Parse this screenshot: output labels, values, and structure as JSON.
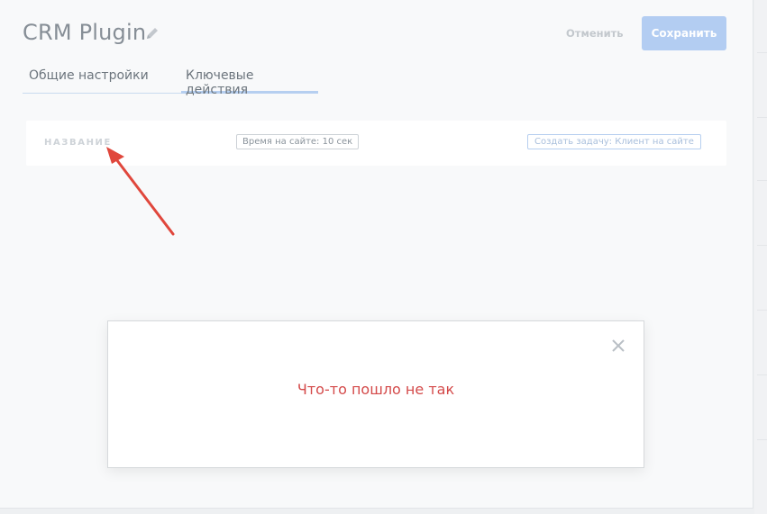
{
  "header": {
    "title": "CRM Plugin",
    "cancel_label": "Отменить",
    "save_label": "Сохранить"
  },
  "tabs": [
    {
      "label": "Общие настройки",
      "active": false
    },
    {
      "label": "Ключевые действия",
      "active": true
    }
  ],
  "action_card": {
    "name_placeholder": "НАЗВАНИЕ",
    "trigger": "Время на сайте: 10 сек",
    "action": "Создать задачу: Клиент на сайте"
  },
  "modal": {
    "message": "Что-то пошло не так"
  },
  "colors": {
    "accent": "#b3cdf2",
    "error": "#d44a4a",
    "annotation_arrow": "#e0473c"
  },
  "icons": {
    "edit": "pencil-icon",
    "close": "close-icon"
  }
}
